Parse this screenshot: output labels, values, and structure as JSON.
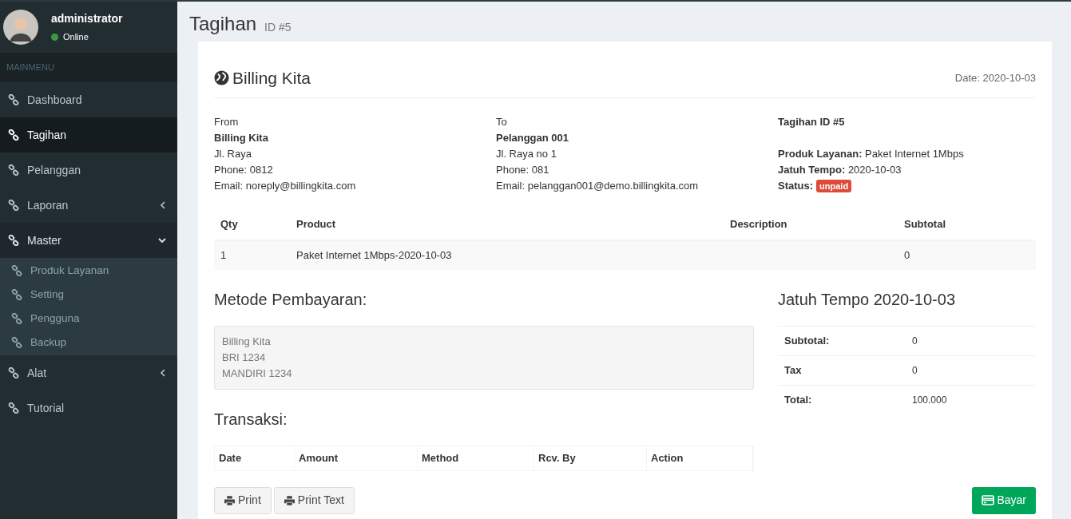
{
  "user": {
    "name": "administrator",
    "status": "Online"
  },
  "sidebar": {
    "header": "MAINMENU",
    "items": [
      {
        "label": "Dashboard",
        "selected": false,
        "kind": "link"
      },
      {
        "label": "Tagihan",
        "selected": true,
        "kind": "link"
      },
      {
        "label": "Pelanggan",
        "selected": false,
        "kind": "link"
      },
      {
        "label": "Laporan",
        "selected": false,
        "kind": "tree",
        "expanded": false
      },
      {
        "label": "Master",
        "selected": false,
        "kind": "tree",
        "expanded": true,
        "children": [
          {
            "label": "Produk Layanan",
            "selected": false
          },
          {
            "label": "Setting",
            "selected": false
          },
          {
            "label": "Pengguna",
            "selected": false
          },
          {
            "label": "Backup",
            "selected": false
          }
        ]
      },
      {
        "label": "Alat",
        "selected": false,
        "kind": "tree",
        "expanded": false
      },
      {
        "label": "Tutorial",
        "selected": false,
        "kind": "link"
      }
    ]
  },
  "page": {
    "title": "Tagihan",
    "subtitle": "ID #5"
  },
  "invoice": {
    "company": "Billing Kita",
    "date": "Date: 2020-10-03",
    "from": {
      "label": "From",
      "name": "Billing Kita",
      "lines": [
        "Jl. Raya",
        "Phone: 0812",
        "Email: noreply@billingkita.com"
      ]
    },
    "to": {
      "label": "To",
      "name": "Pelanggan 001",
      "lines": [
        "Jl. Raya no 1",
        "Phone: 081",
        "Email: pelanggan001@demo.billingkita.com"
      ]
    },
    "info": {
      "title": "Tagihan ID #5",
      "lines": [
        "**Produk Layanan:** Paket Internet 1Mbps",
        "**Jatuh Tempo:** 2020-10-03"
      ],
      "status_label": "Status:",
      "status": {
        "text": "unpaid",
        "color": "#dd4b39"
      }
    },
    "items_table": {
      "columns": [
        "Qty",
        "Product",
        "Description",
        "Subtotal"
      ],
      "rows": [
        [
          "1",
          "Paket Internet 1Mbps-2020-10-03",
          "",
          "0"
        ]
      ]
    },
    "payment": {
      "title": "Metode Pembayaran:",
      "lines": [
        "Billing Kita",
        "BRI 1234",
        "MANDIRI 1234"
      ]
    },
    "transactions": {
      "title": "Transaksi:",
      "columns": [
        "Date",
        "Amount",
        "Method",
        "Rcv. By",
        "Action"
      ]
    },
    "due": {
      "title": "Jatuh Tempo 2020-10-03",
      "rows": [
        [
          "Subtotal:",
          "0"
        ],
        [
          "Tax",
          "0"
        ],
        [
          "Total:",
          "100.000"
        ]
      ]
    },
    "buttons": [
      {
        "label": "Print",
        "kind": "print"
      },
      {
        "label": "Print Text",
        "kind": "print"
      },
      {
        "label": "Bayar",
        "kind": "pay"
      }
    ]
  }
}
